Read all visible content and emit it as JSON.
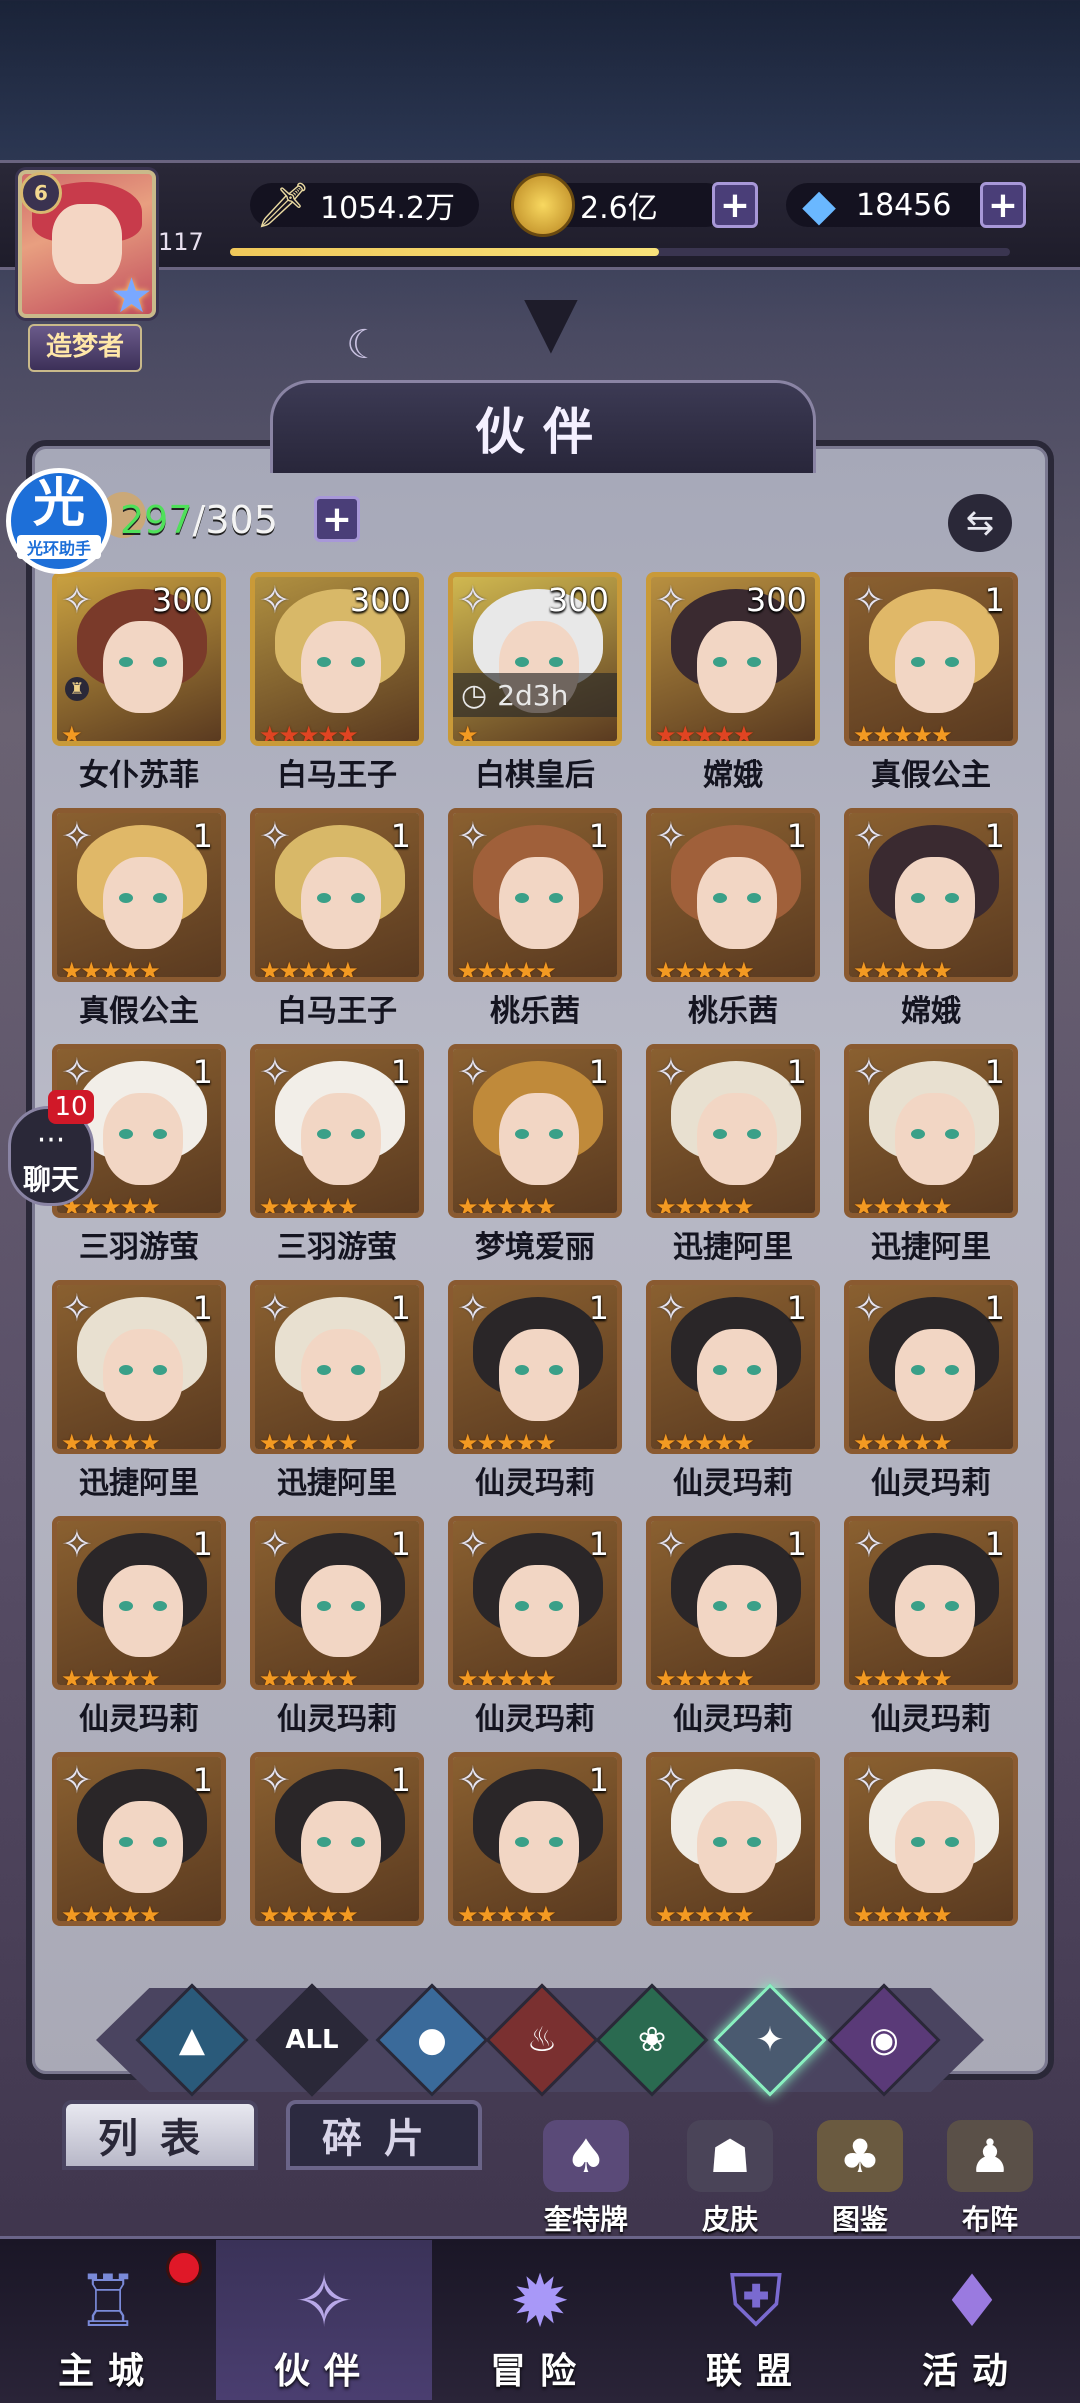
{
  "player": {
    "level": "6",
    "exp": "117",
    "exp_progress": 0.55,
    "title": "造梦者"
  },
  "resources": {
    "power": "1054.2万",
    "gold": "2.6亿",
    "diamonds": "18456",
    "plus": "+"
  },
  "header": {
    "title": "伙伴"
  },
  "roster": {
    "owned": "297",
    "slash": "/",
    "capacity": "305",
    "sort_icon": "⇆"
  },
  "card_labels": {
    "timer_clock": "◷",
    "star": "★",
    "five_stars": "★★★★★",
    "one_star": "★",
    "lock": "♜"
  },
  "cards": [
    {
      "name": "女仆苏菲",
      "count": "300",
      "stars": "★",
      "hair": "#7a3a2a",
      "bg": "#c8a040",
      "gold": true
    },
    {
      "name": "白马王子",
      "count": "300",
      "stars": "★★★★★",
      "hair": "#d8b868",
      "bg": "#b09040",
      "gold": true,
      "red": true
    },
    {
      "name": "白棋皇后",
      "count": "300",
      "stars": "★",
      "hair": "#e8e8e8",
      "bg": "#d0b850",
      "gold": true,
      "timer": "2d3h"
    },
    {
      "name": "嫦娥",
      "count": "300",
      "stars": "★★★★★",
      "hair": "#3a2a30",
      "bg": "#b89040",
      "gold": true,
      "red": true
    },
    {
      "name": "真假公主",
      "count": "1",
      "stars": "★★★★★",
      "hair": "#e0b868",
      "bg": "#8a6030"
    },
    {
      "name": "真假公主",
      "count": "1",
      "stars": "★★★★★",
      "hair": "#e0b868",
      "bg": "#8a6030"
    },
    {
      "name": "白马王子",
      "count": "1",
      "stars": "★★★★★",
      "hair": "#d8b868",
      "bg": "#8a6030"
    },
    {
      "name": "桃乐茜",
      "count": "1",
      "stars": "★★★★★",
      "hair": "#a0603a",
      "bg": "#8a6030"
    },
    {
      "name": "桃乐茜",
      "count": "1",
      "stars": "★★★★★",
      "hair": "#a0603a",
      "bg": "#8a6030"
    },
    {
      "name": "嫦娥",
      "count": "1",
      "stars": "★★★★★",
      "hair": "#3a2a30",
      "bg": "#8a6030"
    },
    {
      "name": "三羽游萤",
      "count": "1",
      "stars": "★★★★★",
      "hair": "#f2eee8",
      "bg": "#8a6030"
    },
    {
      "name": "三羽游萤",
      "count": "1",
      "stars": "★★★★★",
      "hair": "#f2eee8",
      "bg": "#8a6030"
    },
    {
      "name": "梦境爱丽",
      "count": "1",
      "stars": "★★★★★",
      "hair": "#c08a3a",
      "bg": "#8a6030"
    },
    {
      "name": "迅捷阿里",
      "count": "1",
      "stars": "★★★★★",
      "hair": "#e8e0d0",
      "bg": "#8a6030"
    },
    {
      "name": "迅捷阿里",
      "count": "1",
      "stars": "★★★★★",
      "hair": "#e8e0d0",
      "bg": "#8a6030"
    },
    {
      "name": "迅捷阿里",
      "count": "1",
      "stars": "★★★★★",
      "hair": "#e8e0d0",
      "bg": "#8a6030"
    },
    {
      "name": "迅捷阿里",
      "count": "1",
      "stars": "★★★★★",
      "hair": "#e8e0d0",
      "bg": "#8a6030"
    },
    {
      "name": "仙灵玛莉",
      "count": "1",
      "stars": "★★★★★",
      "hair": "#2a2628",
      "bg": "#8a6030"
    },
    {
      "name": "仙灵玛莉",
      "count": "1",
      "stars": "★★★★★",
      "hair": "#2a2628",
      "bg": "#8a6030"
    },
    {
      "name": "仙灵玛莉",
      "count": "1",
      "stars": "★★★★★",
      "hair": "#2a2628",
      "bg": "#8a6030"
    },
    {
      "name": "仙灵玛莉",
      "count": "1",
      "stars": "★★★★★",
      "hair": "#2a2628",
      "bg": "#8a6030"
    },
    {
      "name": "仙灵玛莉",
      "count": "1",
      "stars": "★★★★★",
      "hair": "#2a2628",
      "bg": "#8a6030"
    },
    {
      "name": "仙灵玛莉",
      "count": "1",
      "stars": "★★★★★",
      "hair": "#2a2628",
      "bg": "#8a6030"
    },
    {
      "name": "仙灵玛莉",
      "count": "1",
      "stars": "★★★★★",
      "hair": "#2a2628",
      "bg": "#8a6030"
    },
    {
      "name": "仙灵玛莉",
      "count": "1",
      "stars": "★★★★★",
      "hair": "#2a2628",
      "bg": "#8a6030"
    },
    {
      "name": "",
      "count": "1",
      "stars": "★★★★★",
      "hair": "#2a2628",
      "bg": "#8a6030"
    },
    {
      "name": "",
      "count": "1",
      "stars": "★★★★★",
      "hair": "#2a2628",
      "bg": "#8a6030"
    },
    {
      "name": "",
      "count": "1",
      "stars": "★★★★★",
      "hair": "#2a2628",
      "bg": "#8a6030"
    },
    {
      "name": "",
      "count": "",
      "stars": "★★★★★",
      "hair": "#f0ece4",
      "bg": "#8a6030"
    },
    {
      "name": "",
      "count": "",
      "stars": "★★★★★",
      "hair": "#f0ece4",
      "bg": "#8a6030"
    }
  ],
  "filters": [
    {
      "icon": "▲",
      "color": "#2a5a7a",
      "name": "filter-water-icon"
    },
    {
      "icon": "ALL",
      "color": "#2a2838",
      "name": "filter-all-icon"
    },
    {
      "icon": "●",
      "color": "#3a6a9a",
      "name": "filter-droplet-icon"
    },
    {
      "icon": "♨",
      "color": "#7a3030",
      "name": "filter-fire-icon"
    },
    {
      "icon": "❀",
      "color": "#2a6a50",
      "name": "filter-nature-icon"
    },
    {
      "icon": "✦",
      "color": "#4a5a70",
      "name": "filter-light-icon"
    },
    {
      "icon": "◉",
      "color": "#5a3a78",
      "name": "filter-dark-icon"
    }
  ],
  "tabs": {
    "list": "列表",
    "shards": "碎片"
  },
  "sub_buttons": [
    {
      "label": "奎特牌",
      "icon": "♠",
      "color": "#5a4a78"
    },
    {
      "label": "皮肤",
      "icon": "☗",
      "color": "#4a4458"
    },
    {
      "label": "图鉴",
      "icon": "♣",
      "color": "#6a5a40"
    },
    {
      "label": "布阵",
      "icon": "♟",
      "color": "#5a5048"
    }
  ],
  "nav": [
    {
      "label": "主城",
      "icon": "♖"
    },
    {
      "label": "伙伴",
      "icon": "✧"
    },
    {
      "label": "冒险",
      "icon": "✹"
    },
    {
      "label": "联盟",
      "icon": "⛨"
    },
    {
      "label": "活动",
      "icon": "♦"
    }
  ],
  "widgets": {
    "assist_big": "光",
    "assist_small": "光环助手",
    "chat_label": "聊天",
    "chat_count": "10",
    "chat_bubble": "···"
  }
}
